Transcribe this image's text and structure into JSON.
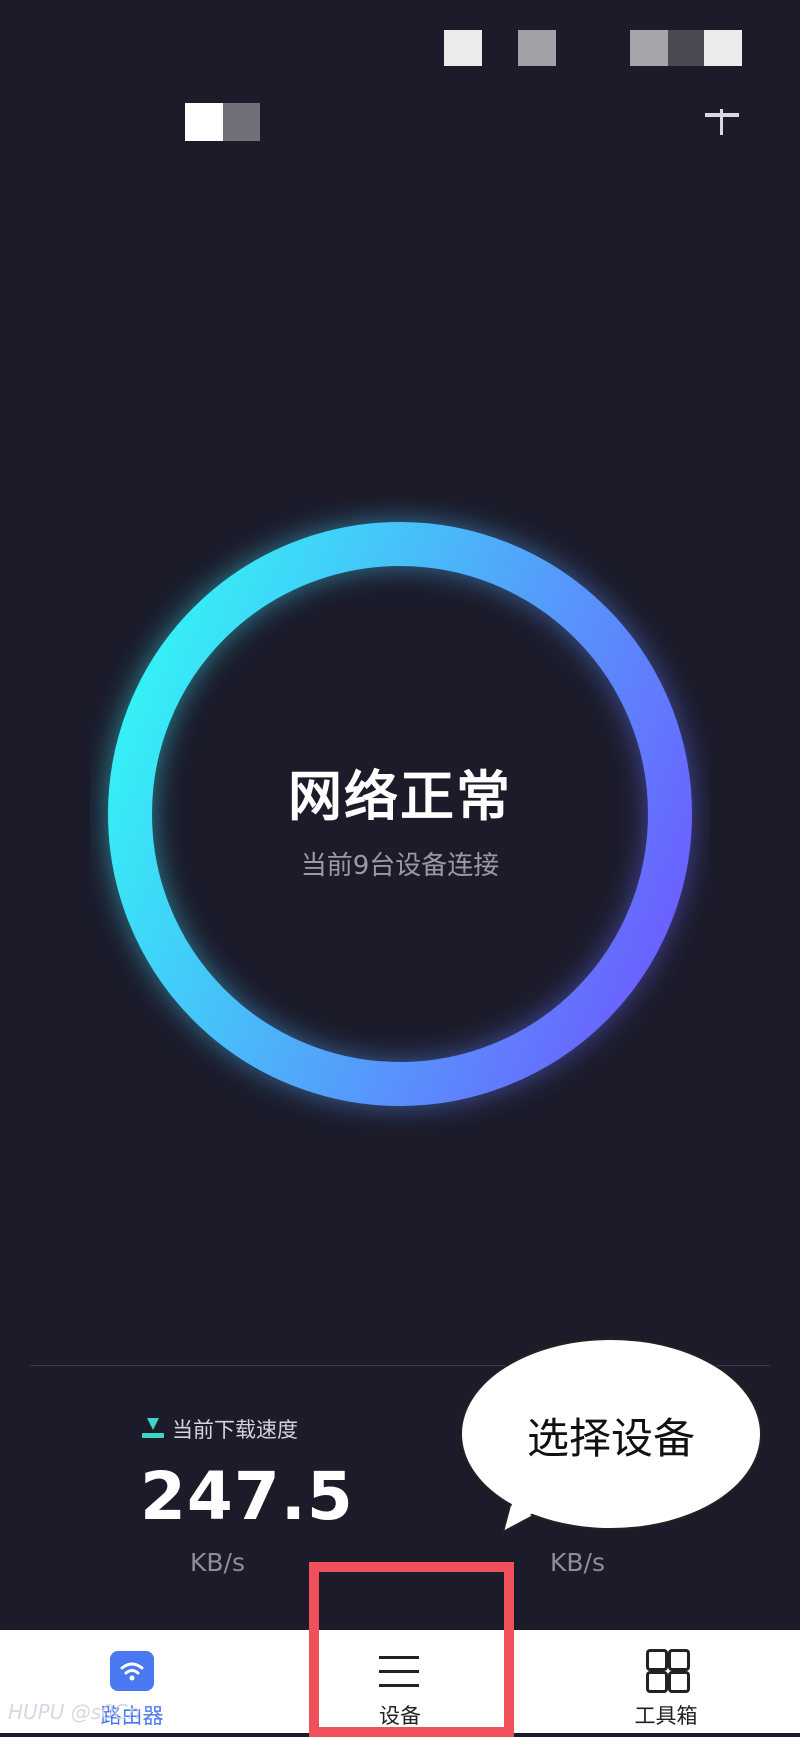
{
  "status": {
    "title": "网络正常",
    "subtitle": "当前9台设备连接"
  },
  "speed": {
    "download_label": "当前下载速度",
    "download_value": "247.5",
    "download_unit": "KB/s",
    "upload_unit": "KB/s"
  },
  "callout": {
    "text": "选择设备"
  },
  "tabs": {
    "router_label": "路由器",
    "device_label": "设备",
    "tools_label": "工具箱"
  },
  "watermark": "HUPU @s0Cn",
  "colors": {
    "background": "#1b1b2a",
    "ring_start": "#35f0f6",
    "ring_end": "#6a62ff",
    "accent_blue": "#4a78f0",
    "download_icon": "#3fd4c8",
    "highlight": "#f0505a"
  },
  "icons": {
    "add": "plus-icon",
    "download": "download-icon",
    "router": "wifi-icon",
    "device": "menu-icon",
    "tools": "grid-icon"
  }
}
